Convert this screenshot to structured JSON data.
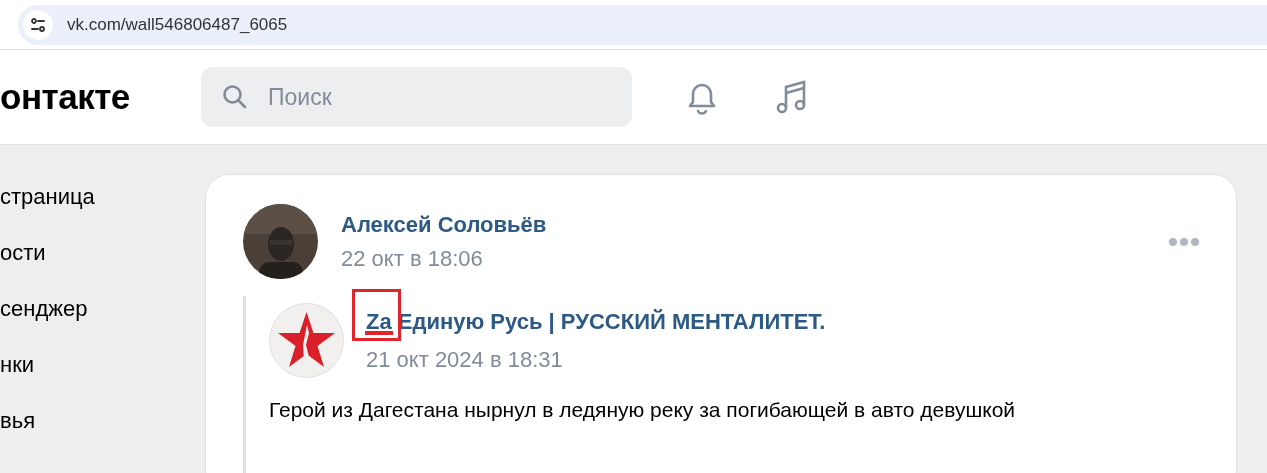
{
  "address_bar": {
    "url": "vk.com/wall546806487_6065"
  },
  "header": {
    "logo": "онтакте",
    "search": {
      "placeholder": "Поиск"
    }
  },
  "sidebar": {
    "items": [
      {
        "label": "страница"
      },
      {
        "label": "ости"
      },
      {
        "label": "сенджер"
      },
      {
        "label": "нки"
      },
      {
        "label": "вья"
      }
    ]
  },
  "post": {
    "author": "Алексей Соловьёв",
    "date": "22 окт в 18:06",
    "repost": {
      "author": "Za Единую Русь | РУССКИЙ МЕНТАЛИТЕТ.",
      "date": "21 окт 2024 в 18:31",
      "text": "Герой из Дагестана нырнул в ледяную реку за погибающей в авто девушкой"
    }
  },
  "annotation": {
    "kind": "highlight-box",
    "color": "#e0242b"
  }
}
